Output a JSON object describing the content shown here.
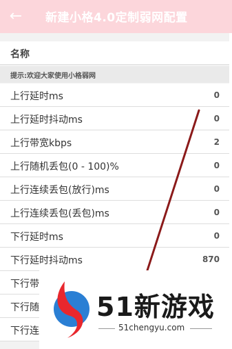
{
  "header": {
    "title": "新建小格4.0定制弱网配置",
    "back_icon": "arrow-left-icon"
  },
  "name_field": {
    "label": "名称"
  },
  "hint": "提示:欢迎大家使用小格弱网",
  "params": [
    {
      "label": "上行延时ms",
      "value": "0"
    },
    {
      "label": "上行延时抖动ms",
      "value": "0"
    },
    {
      "label": "上行带宽kbps",
      "value": "2"
    },
    {
      "label": "上行随机丢包(0 - 100)%",
      "value": "0"
    },
    {
      "label": "上行连续丢包(放行)ms",
      "value": "0"
    },
    {
      "label": "上行连续丢包(丢包)ms",
      "value": "0"
    },
    {
      "label": "下行延时ms",
      "value": "0"
    },
    {
      "label": "下行延时抖动ms",
      "value": "870"
    },
    {
      "label": "下行带",
      "value": ""
    },
    {
      "label": "下行随",
      "value": ""
    },
    {
      "label": "下行连",
      "value": ""
    }
  ],
  "watermark": {
    "brand": "51新游戏",
    "url": "51chengyu.com"
  },
  "colors": {
    "titlebar": "#fcd6db",
    "slash": "#8b1a1a"
  }
}
